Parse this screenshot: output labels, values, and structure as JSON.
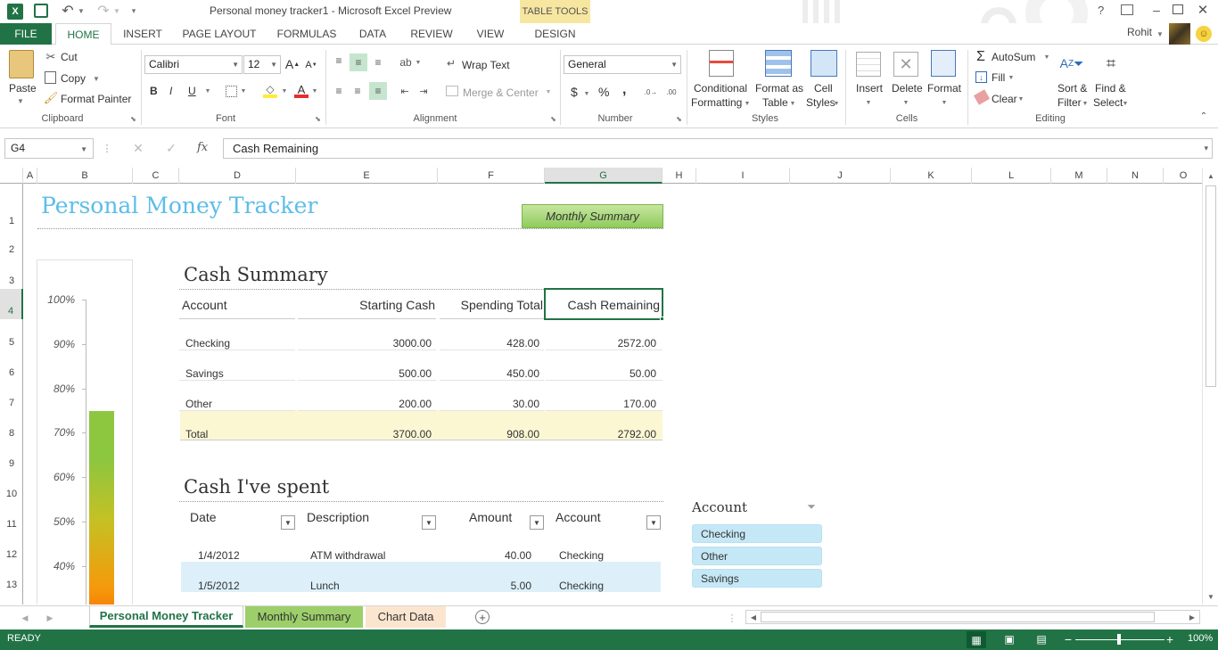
{
  "window": {
    "title": "Personal money tracker1 - Microsoft Excel Preview",
    "context_tab_group": "TABLE TOOLS",
    "user": "Rohit",
    "help": "?"
  },
  "ribbon_tabs": [
    "FILE",
    "HOME",
    "INSERT",
    "PAGE LAYOUT",
    "FORMULAS",
    "DATA",
    "REVIEW",
    "VIEW",
    "DESIGN"
  ],
  "ribbon": {
    "clipboard": {
      "paste": "Paste",
      "cut": "Cut",
      "copy": "Copy",
      "format_painter": "Format Painter",
      "label": "Clipboard"
    },
    "font": {
      "name": "Calibri",
      "size": "12",
      "bold": "B",
      "italic": "I",
      "underline": "U",
      "label": "Font"
    },
    "alignment": {
      "wrap": "Wrap Text",
      "merge": "Merge & Center",
      "label": "Alignment"
    },
    "number": {
      "format": "General",
      "currency": "$",
      "percent": "%",
      "comma": ",",
      "label": "Number"
    },
    "styles": {
      "conditional": "Conditional",
      "conditional2": "Formatting",
      "format_as": "Format as",
      "format_as2": "Table",
      "cell": "Cell",
      "cell2": "Styles",
      "label": "Styles"
    },
    "cells": {
      "insert": "Insert",
      "delete": "Delete",
      "format": "Format",
      "label": "Cells"
    },
    "editing": {
      "autosum": "AutoSum",
      "fill": "Fill",
      "clear": "Clear",
      "sort": "Sort &",
      "sort2": "Filter",
      "find": "Find &",
      "find2": "Select",
      "label": "Editing"
    }
  },
  "formula_bar": {
    "name_box": "G4",
    "fx": "fx",
    "content": "Cash Remaining"
  },
  "columns": [
    "A",
    "B",
    "C",
    "D",
    "E",
    "F",
    "G",
    "H",
    "I",
    "J",
    "K",
    "L",
    "M",
    "N",
    "O"
  ],
  "rows": [
    "1",
    "2",
    "3",
    "4",
    "5",
    "6",
    "7",
    "8",
    "9",
    "10",
    "11",
    "12",
    "13"
  ],
  "sheet": {
    "title": "Personal Money Tracker",
    "monthly_button": "Monthly Summary",
    "gauge_ticks": [
      "100%",
      "90%",
      "80%",
      "70%",
      "60%",
      "50%",
      "40%"
    ],
    "gauge_fill": 0.75,
    "cash_summary": {
      "heading": "Cash Summary",
      "headers": [
        "Account",
        "Starting Cash",
        "Spending Total",
        "Cash Remaining"
      ],
      "rows": [
        [
          "Checking",
          "3000.00",
          "428.00",
          "2572.00"
        ],
        [
          "Savings",
          "500.00",
          "450.00",
          "50.00"
        ],
        [
          "Other",
          "200.00",
          "30.00",
          "170.00"
        ],
        [
          "Total",
          "3700.00",
          "908.00",
          "2792.00"
        ]
      ]
    },
    "cash_spent": {
      "heading": "Cash I've spent",
      "headers": [
        "Date",
        "Description",
        "Amount",
        "Account"
      ],
      "rows": [
        [
          "1/4/2012",
          "ATM withdrawal",
          "40.00",
          "Checking"
        ],
        [
          "1/5/2012",
          "Lunch",
          "5.00",
          "Checking"
        ]
      ]
    },
    "slicer": {
      "title": "Account",
      "items": [
        "Checking",
        "Other",
        "Savings"
      ]
    }
  },
  "sheet_tabs": [
    "Personal Money Tracker",
    "Monthly Summary",
    "Chart Data"
  ],
  "status": {
    "ready": "READY",
    "zoom": "100%"
  }
}
